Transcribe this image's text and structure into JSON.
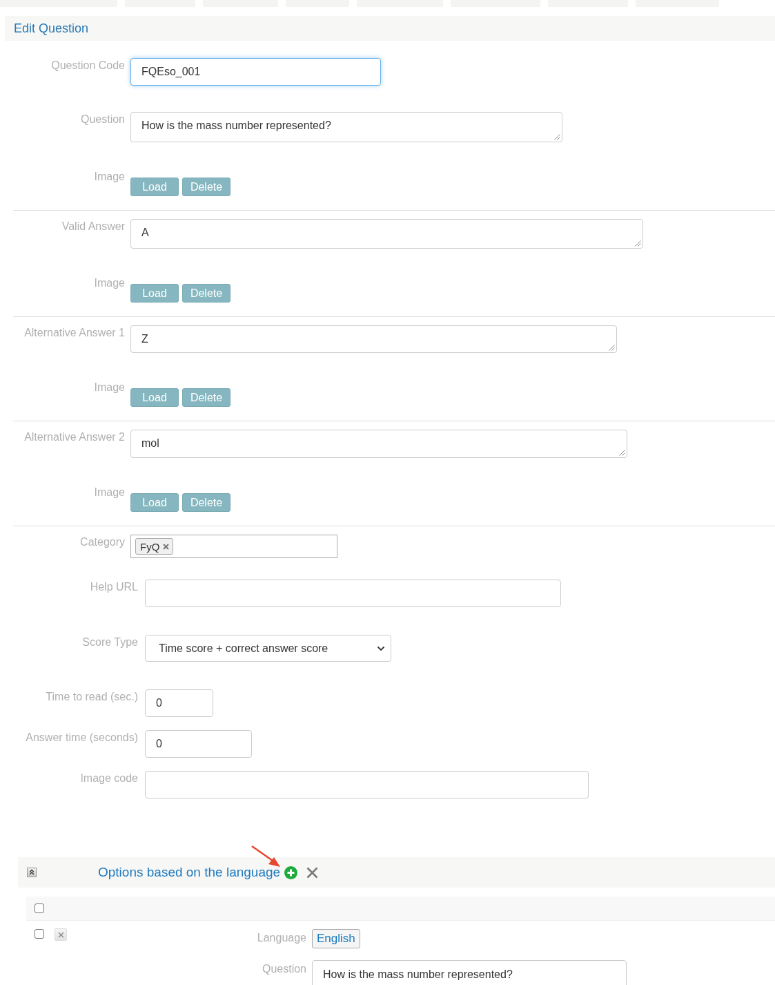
{
  "tabs": [
    {
      "selected": false
    },
    {
      "selected": false
    },
    {
      "selected": false
    },
    {
      "selected": false
    },
    {
      "selected": false
    },
    {
      "selected": false
    },
    {
      "selected": false
    },
    {
      "selected": false
    }
  ],
  "header": {
    "title": "Edit Question"
  },
  "sections": [
    {
      "fields": [
        {
          "kind": "text",
          "label": "Question Code",
          "value": "FQEso_001",
          "focused": true
        },
        {
          "kind": "textarea",
          "label": "Question",
          "value": "How is the mass number represented?",
          "focused": false
        },
        {
          "kind": "image",
          "label": "Image",
          "buttons": [
            "Load",
            "Delete"
          ]
        }
      ]
    },
    {
      "fields": [
        {
          "kind": "textarea",
          "label": "Valid Answer",
          "value": "A",
          "focused": false
        },
        {
          "kind": "image",
          "label": "Image",
          "buttons": [
            "Load",
            "Delete"
          ]
        }
      ]
    },
    {
      "fields": [
        {
          "kind": "textarea",
          "label": "Alternative Answer 1",
          "value": "Z",
          "focused": false
        },
        {
          "kind": "image",
          "label": "Image",
          "buttons": [
            "Load",
            "Delete"
          ]
        }
      ]
    },
    {
      "fields": [
        {
          "kind": "textarea",
          "label": "Alternative Answer 2",
          "value": "mol",
          "focused": false
        },
        {
          "kind": "image",
          "label": "Image",
          "buttons": [
            "Load",
            "Delete"
          ]
        }
      ]
    },
    {
      "fields": [
        {
          "kind": "tags",
          "label": "Category",
          "tags": [
            "FyQ"
          ]
        },
        {
          "kind": "line",
          "label": "Help URL",
          "focused": false
        },
        {
          "kind": "select",
          "label": "Score Type",
          "value": "Time score + correct answer score",
          "focused": false
        },
        {
          "kind": "number",
          "label": "Time to read (sec.)",
          "value": "0",
          "focused": false
        },
        {
          "kind": "number",
          "label": "Answer time (seconds)",
          "value": "0",
          "focused": false
        },
        {
          "kind": "line",
          "label": "Image code",
          "focused": false
        }
      ]
    }
  ],
  "options": {
    "title": "Options based on the language",
    "expanded": true,
    "add_highlighted": true,
    "select_all": {
      "checked": false
    },
    "rows": [
      {
        "checked": false,
        "fields": [
          {
            "kind": "button",
            "label": "Language",
            "value": "English"
          },
          {
            "kind": "textarea",
            "label": "Question",
            "value": "How is the mass number represented?",
            "focused": false
          }
        ]
      }
    ]
  }
}
